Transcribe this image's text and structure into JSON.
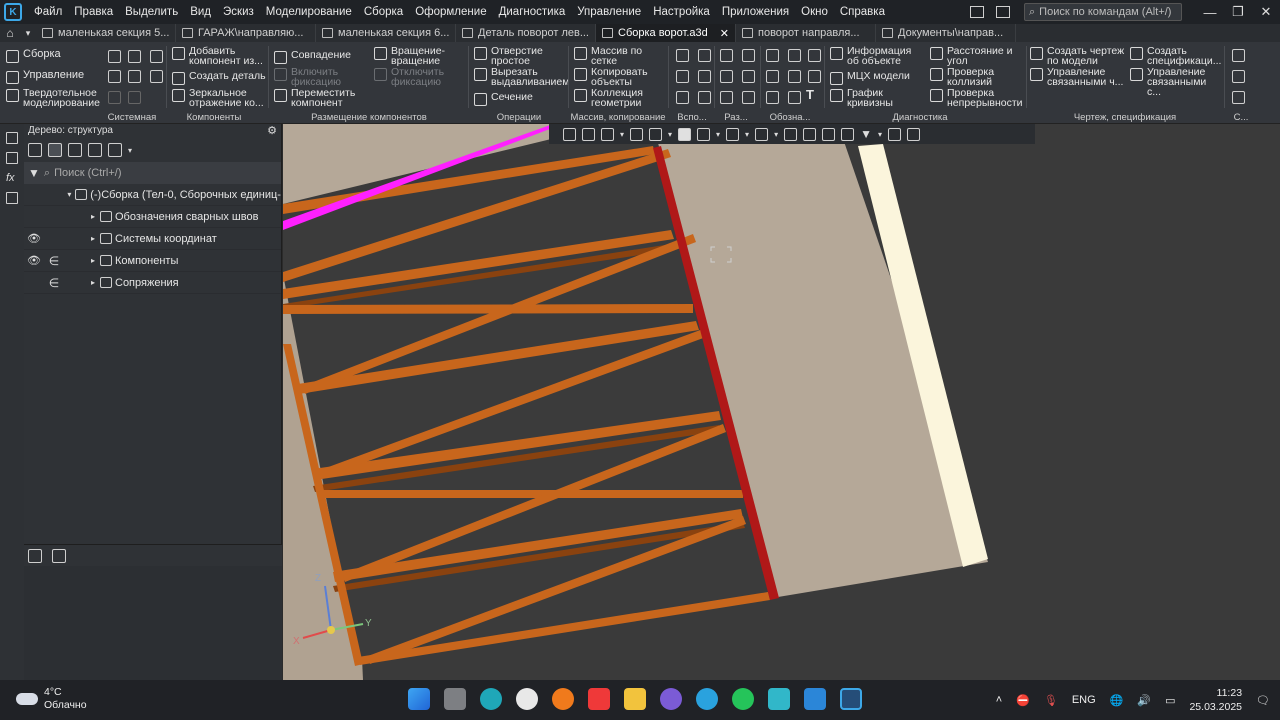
{
  "menubar": {
    "items": [
      "Файл",
      "Правка",
      "Выделить",
      "Вид",
      "Эскиз",
      "Моделирование",
      "Сборка",
      "Оформление",
      "Диагностика",
      "Управление",
      "Настройка",
      "Приложения",
      "Окно",
      "Справка"
    ],
    "search_placeholder": "Поиск по командам (Alt+/)"
  },
  "tabs": [
    {
      "label": "маленькая секция 5...",
      "active": false
    },
    {
      "label": "ГАРАЖ\\направляю...",
      "active": false
    },
    {
      "label": "маленькая секция 6...",
      "active": false
    },
    {
      "label": "Деталь поворот лев...",
      "active": false
    },
    {
      "label": "Сборка ворот.a3d",
      "active": true
    },
    {
      "label": "поворот направля...",
      "active": false
    },
    {
      "label": "Документы\\направ...",
      "active": false
    }
  ],
  "ribbon": {
    "modes": [
      "Сборка",
      "Управление",
      "Твердотельное моделирование"
    ],
    "groups": [
      "Системная",
      "Компоненты",
      "Размещение компонентов",
      "Операции",
      "Массив, копирование",
      "Вспо...",
      "Раз...",
      "Обозна...",
      "Диагностика",
      "Чертеж, спецификация",
      "С..."
    ],
    "buttons": {
      "add_component": "Добавить компонент из...",
      "create_part": "Создать деталь",
      "mirror": "Зеркальное отражение ко...",
      "coincidence": "Совпадение",
      "enable_fix": "Включить фиксацию",
      "move_component": "Переместить компонент",
      "rotation": "Вращение-вращение",
      "disable_fix": "Отключить фиксацию",
      "hole": "Отверстие простое",
      "cut_extrude": "Вырезать выдавливанием",
      "section": "Сечение",
      "grid_array": "Массив по сетке",
      "copy_objects": "Копировать объекты",
      "geometry_collection": "Коллекция геометрии",
      "object_info": "Информация об объекте",
      "mcx": "МЦХ модели",
      "curvature": "График кривизны",
      "distance": "Расстояние и угол",
      "collision": "Проверка коллизий",
      "continuity": "Проверка непрерывности",
      "create_drawing": "Создать чертеж по модели",
      "manage_linked": "Управление связанными ч...",
      "create_spec": "Создать спецификаци...",
      "manage_linked2": "Управление связанными с..."
    }
  },
  "tree": {
    "title": "Дерево: структура",
    "search_placeholder": "Поиск (Ctrl+/)",
    "rows": [
      {
        "label": "(-)Сборка (Тел-0, Сборочных единиц-",
        "eye": false,
        "inc": false,
        "caret": "▾"
      },
      {
        "label": "Обозначения сварных швов",
        "eye": false,
        "inc": false,
        "caret": "▸"
      },
      {
        "label": "Системы координат",
        "eye": true,
        "inc": false,
        "caret": "▸"
      },
      {
        "label": "Компоненты",
        "eye": true,
        "inc": true,
        "caret": "▸"
      },
      {
        "label": "Сопряжения",
        "eye": false,
        "inc": true,
        "caret": "▸"
      }
    ]
  },
  "axes": {
    "x": "X",
    "y": "Y",
    "z": "Z"
  },
  "taskbar": {
    "temp": "4°C",
    "weather": "Облачно",
    "lang": "ENG",
    "time": "11:23",
    "date": "25.03.2025"
  },
  "colors": {
    "beam": "#c8661c",
    "beam_dark": "#8a420f",
    "red_rail": "#b01818",
    "magenta": "#ff20ff",
    "plate": "#b5a898",
    "cream": "#fbf5dc",
    "accent": "#3da8e8"
  }
}
